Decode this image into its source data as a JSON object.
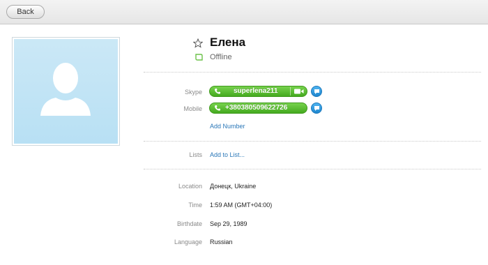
{
  "toolbar": {
    "back_label": "Back"
  },
  "profile": {
    "name": "Елена",
    "status": "Offline",
    "skype_label": "Skype",
    "skype_id": "superlena211",
    "mobile_label": "Mobile",
    "mobile_number": "+380380509622726",
    "add_number": "Add Number",
    "lists_label": "Lists",
    "add_to_list": "Add to List...",
    "location_label": "Location",
    "location": "Донецк, Ukraine",
    "time_label": "Time",
    "time": "1:59 AM (GMT+04:00)",
    "birthdate_label": "Birthdate",
    "birthdate": "Sep 29, 1989",
    "language_label": "Language",
    "language": "Russian"
  },
  "colors": {
    "call_green": "#45aa1f",
    "link_blue": "#2a77b8",
    "chat_blue": "#1e86cf"
  },
  "icons": [
    "star-icon",
    "offline-status-icon",
    "phone-icon",
    "video-icon",
    "chat-icon",
    "default-avatar-icon"
  ]
}
